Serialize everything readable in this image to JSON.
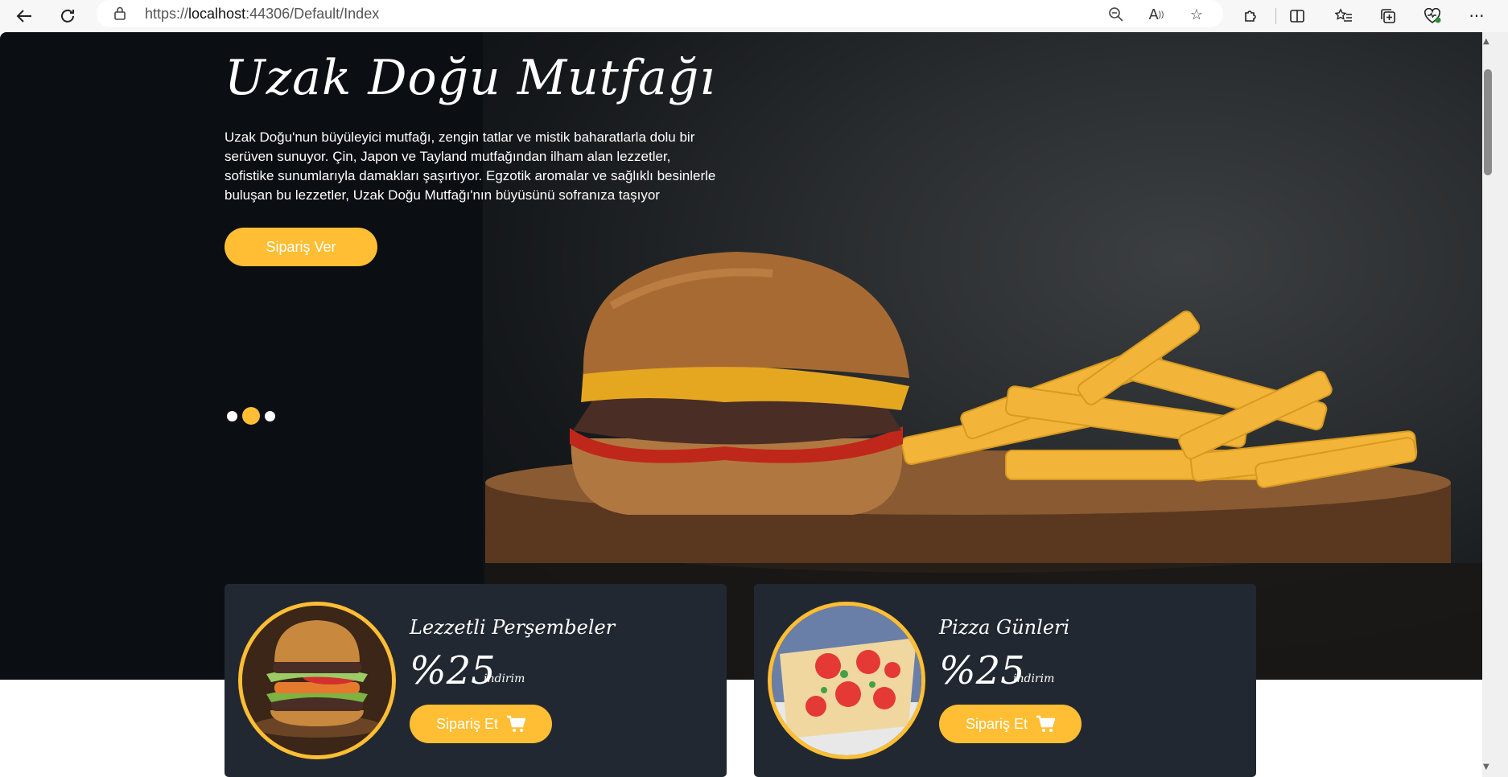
{
  "browser": {
    "url_prefix": "https://",
    "url_host": "localhost",
    "url_rest": ":44306/Default/Index"
  },
  "hero": {
    "title": "Uzak Doğu Mutfağı",
    "description": "Uzak Doğu'nun büyüleyici mutfağı, zengin tatlar ve mistik baharatlarla dolu bir serüven sunuyor. Çin, Japon ve Tayland mutfağından ilham alan lezzetler, sofistike sunumlarıyla damakları şaşırtıyor. Egzotik aromalar ve sağlıklı besinlerle buluşan bu lezzetler, Uzak Doğu Mutfağı'nın büyüsünü sofranıza taşıyor",
    "button_label": "Sipariş Ver",
    "carousel": {
      "slides": 3,
      "active": 2
    }
  },
  "offers": [
    {
      "title": "Lezzetli Perşembeler",
      "percent": "%25",
      "off_label": "indirim",
      "button_label": "Sipariş Et",
      "image": "burger-photo"
    },
    {
      "title": "Pizza Günleri",
      "percent": "%25",
      "off_label": "indirim",
      "button_label": "Sipariş Et",
      "image": "pizza-photo"
    }
  ],
  "colors": {
    "accent": "#ffbe33",
    "card_bg": "#222831",
    "hero_bg": "#0b0e12"
  }
}
